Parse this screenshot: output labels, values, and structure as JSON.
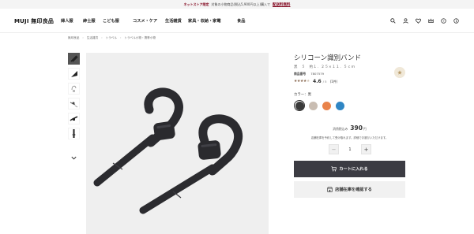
{
  "promo": {
    "badge": "ネットストア限定",
    "text": "対象の小物商品(税込5,900円以上)購入で",
    "highlight": "配送料無料"
  },
  "header": {
    "logo": "MUJI 無印良品",
    "nav": [
      "婦人服",
      "紳士服",
      "こども服",
      "コスメ・ケア",
      "生活雑貨",
      "家具・収納・家電",
      "食品"
    ],
    "icons": [
      "search-icon",
      "user-icon",
      "heart-icon",
      "crown-icon",
      "help-icon",
      "info-icon"
    ]
  },
  "breadcrumb": [
    "無印良品",
    "生活雑貨",
    "トラベル",
    "トラベル小物・携帯小物"
  ],
  "product": {
    "name": "シリコーン識別バンド",
    "size": "黒　５　約１．２５×１１．５ｃｍ",
    "code_label": "商品番号",
    "code": "7807579",
    "stars": "★★★★",
    "star_empty": "★",
    "score": "4.6",
    "score_of": "/ 5",
    "review_count": "(1件)",
    "color_label": "カラー：黒",
    "colors": [
      "#3a3a3a",
      "#c9bdb2",
      "#e9834a",
      "#2f86c4"
    ],
    "tax_label": "消費税込み",
    "price": "390",
    "yen": "円",
    "note": "店舗在庫を予約して受け取れます。詳細でお選びいただけます。",
    "qty": "1",
    "minus": "−",
    "plus": "+",
    "cart_button": "カートに入れる",
    "stock_button": "店舗在庫を確認する"
  }
}
